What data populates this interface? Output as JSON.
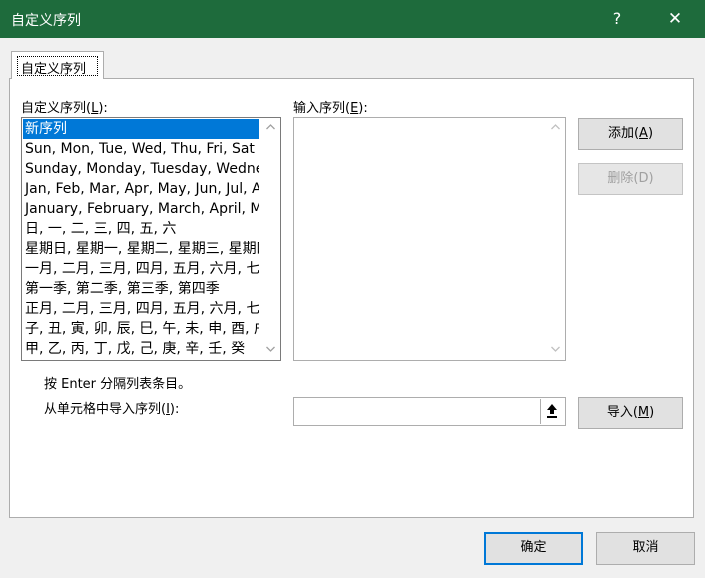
{
  "window": {
    "title": "自定义序列",
    "help_label": "?",
    "close_label": "✕"
  },
  "tab": {
    "label": "自定义序列"
  },
  "custom_lists": {
    "label_prefix": "自定义序列(",
    "label_key": "L",
    "label_suffix": "):",
    "items": [
      "新序列",
      "Sun, Mon, Tue, Wed, Thu, Fri, Sat",
      "Sunday, Monday, Tuesday, Wednesday, Thursday, Friday, Saturday",
      "Jan, Feb, Mar, Apr, May, Jun, Jul, Aug, Sep, Oct, Nov, Dec",
      "January, February, March, April, May, June, July, August, September, October, November, December",
      "日, 一, 二, 三, 四, 五, 六",
      "星期日, 星期一, 星期二, 星期三, 星期四, 星期五, 星期六",
      "一月, 二月, 三月, 四月, 五月, 六月, 七月, 八月, 九月, 十月, 十一月, 十二月",
      "第一季, 第二季, 第三季, 第四季",
      "正月, 二月, 三月, 四月, 五月, 六月, 七月, 八月, 九月, 十月, 十一月, 腊月",
      "子, 丑, 寅, 卯, 辰, 巳, 午, 未, 申, 酉, 戌, 亥",
      "甲, 乙, 丙, 丁, 戊, 己, 庚, 辛, 壬, 癸"
    ],
    "selected_index": 0
  },
  "list_entries": {
    "label_prefix": "输入序列(",
    "label_key": "E",
    "label_suffix": "):",
    "value": ""
  },
  "buttons": {
    "add": {
      "prefix": "添加(",
      "key": "A",
      "suffix": ")"
    },
    "delete": {
      "prefix": "删除(",
      "key": "D",
      "suffix": ")"
    },
    "import": {
      "prefix": "导入(",
      "key": "M",
      "suffix": ")"
    },
    "ok": "确定",
    "cancel": "取消"
  },
  "hint": "按 Enter 分隔列表条目。",
  "import_from": {
    "label_prefix": "从单元格中导入序列(",
    "label_key": "I",
    "label_suffix": "):",
    "value": ""
  },
  "icons": {
    "scroll_up": "chevron-up-icon",
    "scroll_down": "chevron-down-icon",
    "collapse": "collapse-dialog-icon"
  }
}
